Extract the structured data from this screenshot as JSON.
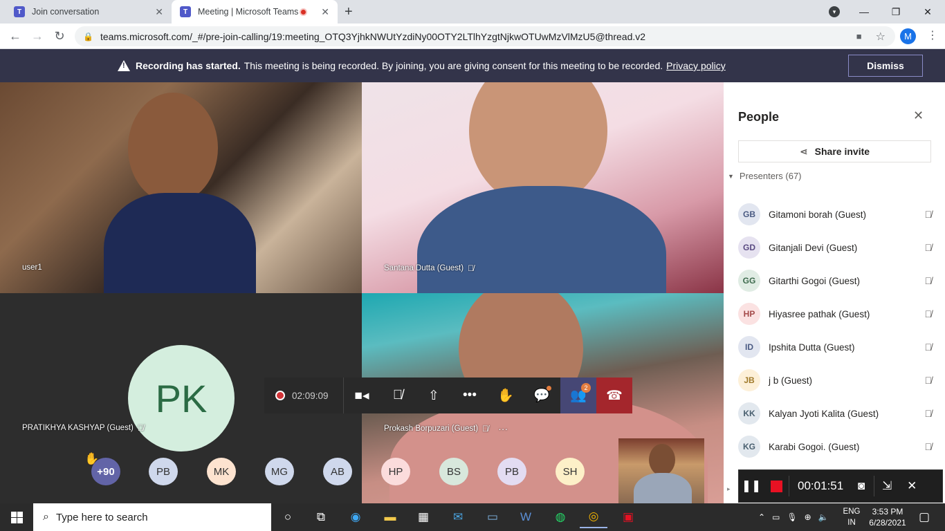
{
  "browser": {
    "tabs": [
      {
        "title": "Join conversation",
        "active": false
      },
      {
        "title": "Meeting | Microsoft Teams",
        "active": true
      }
    ],
    "url": "teams.microsoft.com/_#/pre-join-calling/19:meeting_OTQ3YjhkNWUtYzdiNy00OTY2LTlhYzgtNjkwOTUwMzVlMzU5@thread.v2",
    "profile_initial": "M"
  },
  "banner": {
    "bold": "Recording has started.",
    "message": "This meeting is being recorded. By joining, you are giving consent for this meeting to be recorded.",
    "link": "Privacy policy",
    "dismiss": "Dismiss"
  },
  "tiles": {
    "user1": "user1",
    "santana": "Santana Dutta (Guest)",
    "pratikhya": "PRATIKHYA KASHYAP (Guest)",
    "pratikhya_initials": "PK",
    "prokash": "Prokash Borpuzari (Guest)"
  },
  "controls": {
    "timer": "02:09:09",
    "people_badge": "2"
  },
  "strip": {
    "overflow": "+90",
    "avatars": [
      {
        "initials": "PB",
        "color": "#cfd8ec"
      },
      {
        "initials": "MK",
        "color": "#fde3cf"
      },
      {
        "initials": "MG",
        "color": "#cfd8ec"
      },
      {
        "initials": "AB",
        "color": "#cfd8ec"
      },
      {
        "initials": "HP",
        "color": "#fbdcdc"
      },
      {
        "initials": "BS",
        "color": "#d8e8dc"
      },
      {
        "initials": "PB",
        "color": "#e3dcf2"
      },
      {
        "initials": "SH",
        "color": "#fdf0c8"
      }
    ]
  },
  "panel": {
    "title": "People",
    "share_invite": "Share invite",
    "presenters": "Presenters (67)",
    "people": [
      {
        "initials": "GB",
        "name": "Gitamoni borah (Guest)",
        "bg": "#e2e6f0",
        "fg": "#4a5a82"
      },
      {
        "initials": "GD",
        "name": "Gitanjali Devi (Guest)",
        "bg": "#e6e2f0",
        "fg": "#5a4a82"
      },
      {
        "initials": "GG",
        "name": "Gitarthi Gogoi (Guest)",
        "bg": "#e0ece4",
        "fg": "#3e6b4e"
      },
      {
        "initials": "HP",
        "name": "Hiyasree pathak (Guest)",
        "bg": "#fbe2e2",
        "fg": "#a44a4a"
      },
      {
        "initials": "ID",
        "name": "Ipshita Dutta (Guest)",
        "bg": "#e2e6f0",
        "fg": "#4a5a82"
      },
      {
        "initials": "JB",
        "name": "j b (Guest)",
        "bg": "#fdf0d8",
        "fg": "#a07a2a"
      },
      {
        "initials": "KK",
        "name": "Kalyan Jyoti Kalita (Guest)",
        "bg": "#e2e8ee",
        "fg": "#4a6070"
      },
      {
        "initials": "KG",
        "name": "Karabi Gogoi. (Guest)",
        "bg": "#e2e8ee",
        "fg": "#4a6070"
      }
    ]
  },
  "recorder": {
    "time": "00:01:51"
  },
  "taskbar": {
    "search_placeholder": "Type here to search",
    "lang_top": "ENG",
    "lang_bottom": "IN",
    "time": "3:53 PM",
    "date": "6/28/2021"
  }
}
